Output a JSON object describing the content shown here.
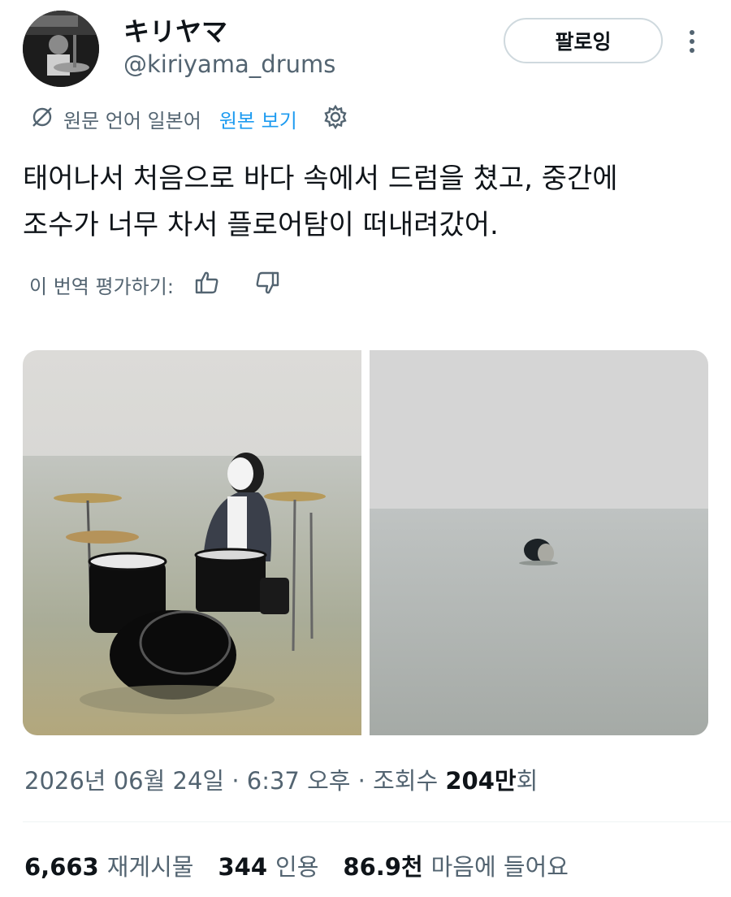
{
  "user": {
    "display_name": "キリヤマ",
    "handle": "@kiriyama_drums",
    "follow_label": "팔로잉"
  },
  "translation": {
    "source_text": "원문 언어 일본어",
    "view_original": "원본 보기"
  },
  "tweet": {
    "line1": "태어나서 처음으로 바다 속에서 드럼을 쳤고, 중간에",
    "line2": "조수가 너무 차서 플로어탐이 떠내려갔어."
  },
  "rating": {
    "label": "이 번역 평가하기:"
  },
  "meta": {
    "date": "2026년 06월 24일",
    "time": "6:37 오후",
    "views_label": "조회수",
    "views_count": "204만",
    "views_suffix": "회"
  },
  "stats": {
    "retweets_count": "6,663",
    "retweets_label": "재게시물",
    "quotes_count": "344",
    "quotes_label": "인용",
    "likes_count": "86.9천",
    "likes_label": "마음에 들어요"
  },
  "icons": {
    "translate": "translate-icon",
    "settings": "gear-icon",
    "like": "thumbs-up-icon",
    "dislike": "thumbs-down-icon",
    "more": "more-vertical-icon"
  },
  "colors": {
    "link": "#1d9bf0",
    "secondary_text": "#536471",
    "primary_text": "#0f1419",
    "border": "#cfd9de"
  }
}
